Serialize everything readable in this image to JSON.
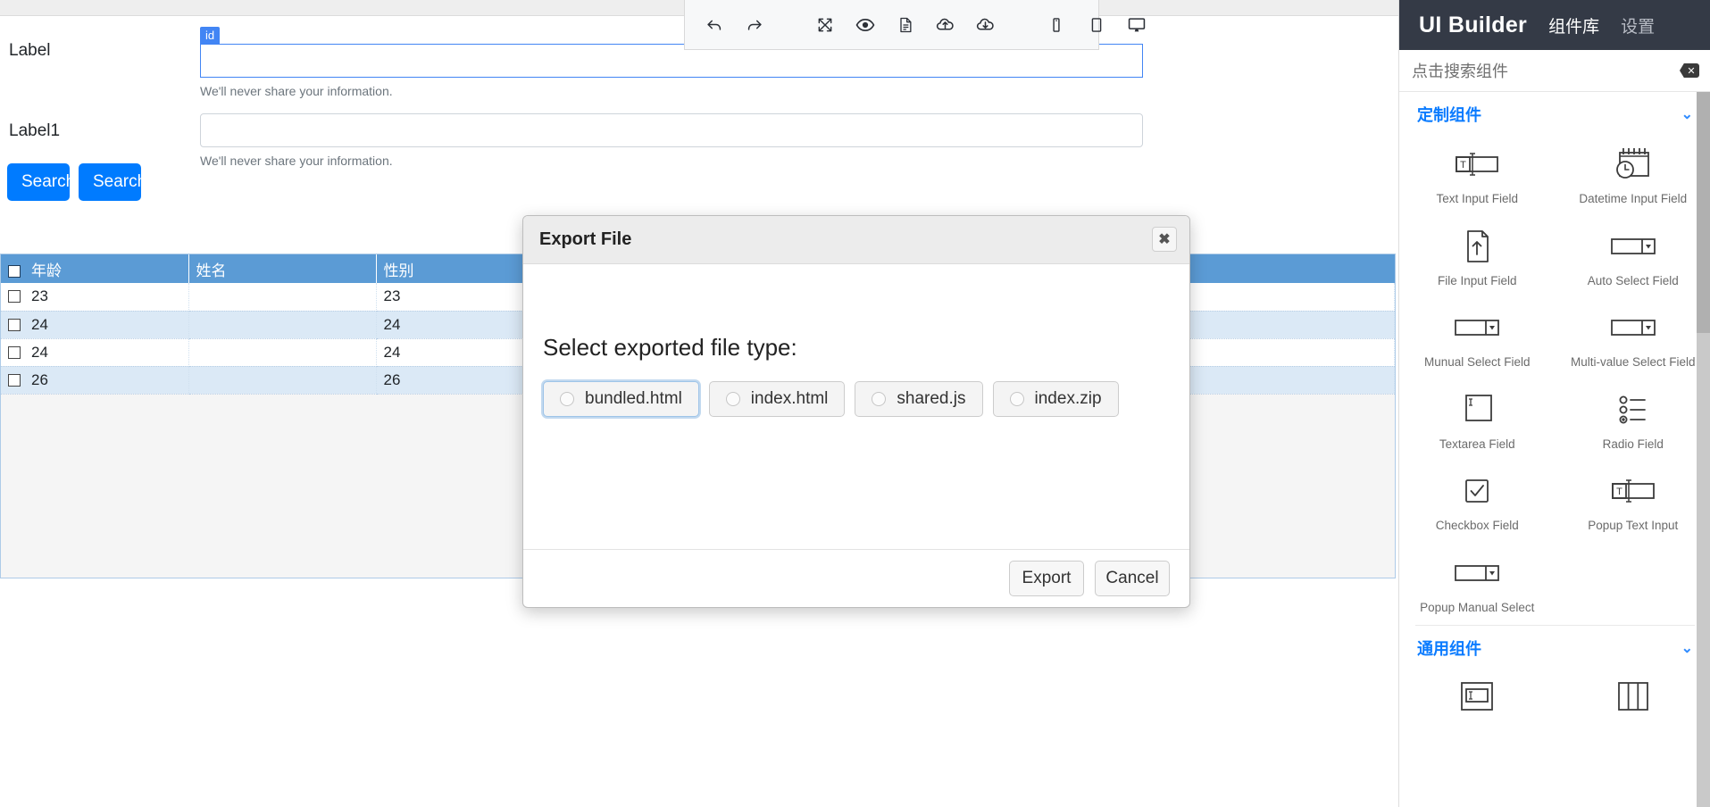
{
  "canvas": {
    "selected_tag": "id",
    "form": {
      "fields": [
        {
          "label": "Label",
          "value": "",
          "help": "We'll never share your information."
        },
        {
          "label": "Label1",
          "value": "",
          "help": "We'll never share your information."
        }
      ],
      "buttons": [
        {
          "label": "Search"
        },
        {
          "label": "Search"
        }
      ]
    },
    "table": {
      "columns": [
        "年龄",
        "姓名",
        "性别"
      ],
      "rows": [
        {
          "age": "23",
          "name": "",
          "gender": "23"
        },
        {
          "age": "24",
          "name": "",
          "gender": "24"
        },
        {
          "age": "24",
          "name": "",
          "gender": "24"
        },
        {
          "age": "26",
          "name": "",
          "gender": "26"
        }
      ]
    }
  },
  "toolbar": {
    "items": [
      {
        "name": "undo-icon",
        "title": "Undo"
      },
      {
        "name": "redo-icon",
        "title": "Redo"
      },
      {
        "name": "fullscreen-icon",
        "title": "Fullscreen"
      },
      {
        "name": "preview-eye-icon",
        "title": "Preview"
      },
      {
        "name": "document-icon",
        "title": "Source"
      },
      {
        "name": "cloud-upload-icon",
        "title": "Upload"
      },
      {
        "name": "cloud-download-icon",
        "title": "Download"
      },
      {
        "name": "mobile-icon",
        "title": "Mobile view"
      },
      {
        "name": "tablet-icon",
        "title": "Tablet view"
      },
      {
        "name": "desktop-icon",
        "title": "Desktop view"
      }
    ]
  },
  "modal": {
    "title": "Export File",
    "close_label": "✖",
    "prompt": "Select exported file type:",
    "options": [
      {
        "label": "bundled.html",
        "selected": false,
        "focused": true
      },
      {
        "label": "index.html",
        "selected": false,
        "focused": false
      },
      {
        "label": "shared.js",
        "selected": false,
        "focused": false
      },
      {
        "label": "index.zip",
        "selected": false,
        "focused": false
      }
    ],
    "confirm_label": "Export",
    "cancel_label": "Cancel"
  },
  "sidebar": {
    "brand": "UI Builder",
    "tabs": [
      {
        "label": "组件库",
        "active": true
      },
      {
        "label": "设置",
        "active": false
      }
    ],
    "search_placeholder": "点击搜索组件",
    "sections": [
      {
        "title": "定制组件",
        "chevron": "⌄",
        "components": [
          {
            "label": "Text Input Field",
            "icon": "text-input-field-icon"
          },
          {
            "label": "Datetime Input Field",
            "icon": "datetime-input-field-icon"
          },
          {
            "label": "File Input Field",
            "icon": "file-input-field-icon"
          },
          {
            "label": "Auto Select Field",
            "icon": "auto-select-field-icon"
          },
          {
            "label": "Munual Select Field",
            "icon": "manual-select-field-icon"
          },
          {
            "label": "Multi-value Select Field",
            "icon": "multi-value-select-field-icon"
          },
          {
            "label": "Textarea Field",
            "icon": "textarea-field-icon"
          },
          {
            "label": "Radio Field",
            "icon": "radio-field-icon"
          },
          {
            "label": "Checkbox Field",
            "icon": "checkbox-field-icon"
          },
          {
            "label": "Popup Text Input",
            "icon": "popup-text-input-icon"
          },
          {
            "label": "Popup Manual Select",
            "icon": "popup-manual-select-icon"
          }
        ]
      },
      {
        "title": "通用组件",
        "chevron": "⌄",
        "components": [
          {
            "label": "",
            "icon": "input-box-icon"
          },
          {
            "label": "",
            "icon": "columns-icon"
          }
        ]
      }
    ]
  },
  "colors": {
    "accent_blue": "#007bff",
    "selection_blue": "#4285f4",
    "table_header_blue": "#5b9bd5",
    "sidebar_dark": "#343a46",
    "link_blue": "#0a7bff"
  }
}
